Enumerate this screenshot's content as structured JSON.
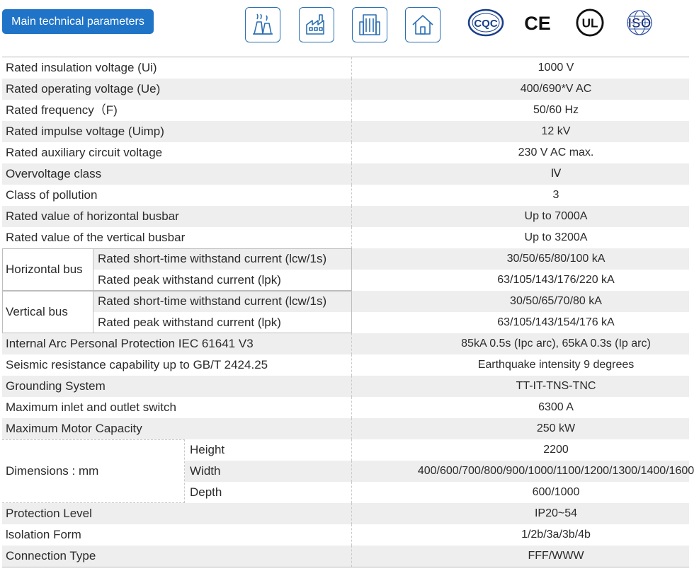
{
  "header": {
    "title": "Main technical parameters",
    "icons": [
      "power-plant-icon",
      "factory-icon",
      "office-building-icon",
      "house-icon"
    ],
    "certifications": [
      "CQC",
      "CE",
      "UL",
      "ISO"
    ],
    "accent_color": "#1f74c8"
  },
  "rows": [
    {
      "label": "Rated insulation voltage (Ui)",
      "value": "1000 V"
    },
    {
      "label": "Rated operating voltage (Ue)",
      "value": "400/690*V AC"
    },
    {
      "label": "Rated frequency（F)",
      "value": "50/60 Hz"
    },
    {
      "label": "Rated impulse voltage (Uimp)",
      "value": "12 kV"
    },
    {
      "label": "Rated auxiliary circuit voltage",
      "value": "230 V AC max."
    },
    {
      "label": "Overvoltage class",
      "value": "Ⅳ"
    },
    {
      "label": "Class of pollution",
      "value": "3"
    },
    {
      "label": "Rated value of horizontal busbar",
      "value": "Up to 7000A"
    },
    {
      "label": "Rated value of the vertical busbar",
      "value": "Up to 3200A"
    }
  ],
  "horizontal_bus": {
    "label": "Horizontal bus",
    "items": [
      {
        "label": "Rated short-time withstand current (lcw/1s)",
        "value": "30/50/65/80/100 kA"
      },
      {
        "label": "Rated peak withstand current (lpk)",
        "value": "63/105/143/176/220 kA"
      }
    ]
  },
  "vertical_bus": {
    "label": "Vertical bus",
    "items": [
      {
        "label": "Rated short-time withstand current (lcw/1s)",
        "value": "30/50/65/70/80 kA"
      },
      {
        "label": "Rated peak withstand current (lpk)",
        "value": "63/105/143/154/176 kA"
      }
    ]
  },
  "rows2": [
    {
      "label": "Internal Arc Personal Protection IEC 61641 V3",
      "value": "85kA 0.5s (Ipc arc), 65kA 0.3s (Ip arc)"
    },
    {
      "label": "Seismic resistance capability up to GB/T 2424.25",
      "value": "Earthquake intensity 9 degrees"
    },
    {
      "label": "Grounding System",
      "value": "TT-IT-TNS-TNC"
    },
    {
      "label": "Maximum inlet and outlet switch",
      "value": "6300 A"
    },
    {
      "label": "Maximum Motor Capacity",
      "value": "250 kW"
    }
  ],
  "dimensions": {
    "label": "Dimensions : mm",
    "items": [
      {
        "label": "Height",
        "value": "2200"
      },
      {
        "label": "Width",
        "value": "400/600/700/800/900/1000/1100/1200/1300/1400/1600"
      },
      {
        "label": "Depth",
        "value": "600/1000"
      }
    ]
  },
  "rows3": [
    {
      "label": "Protection Level",
      "value": "IP20~54"
    },
    {
      "label": "lsolation Form",
      "value": "1/2b/3a/3b/4b"
    },
    {
      "label": "Connection Type",
      "value": "FFF/WWW"
    }
  ]
}
